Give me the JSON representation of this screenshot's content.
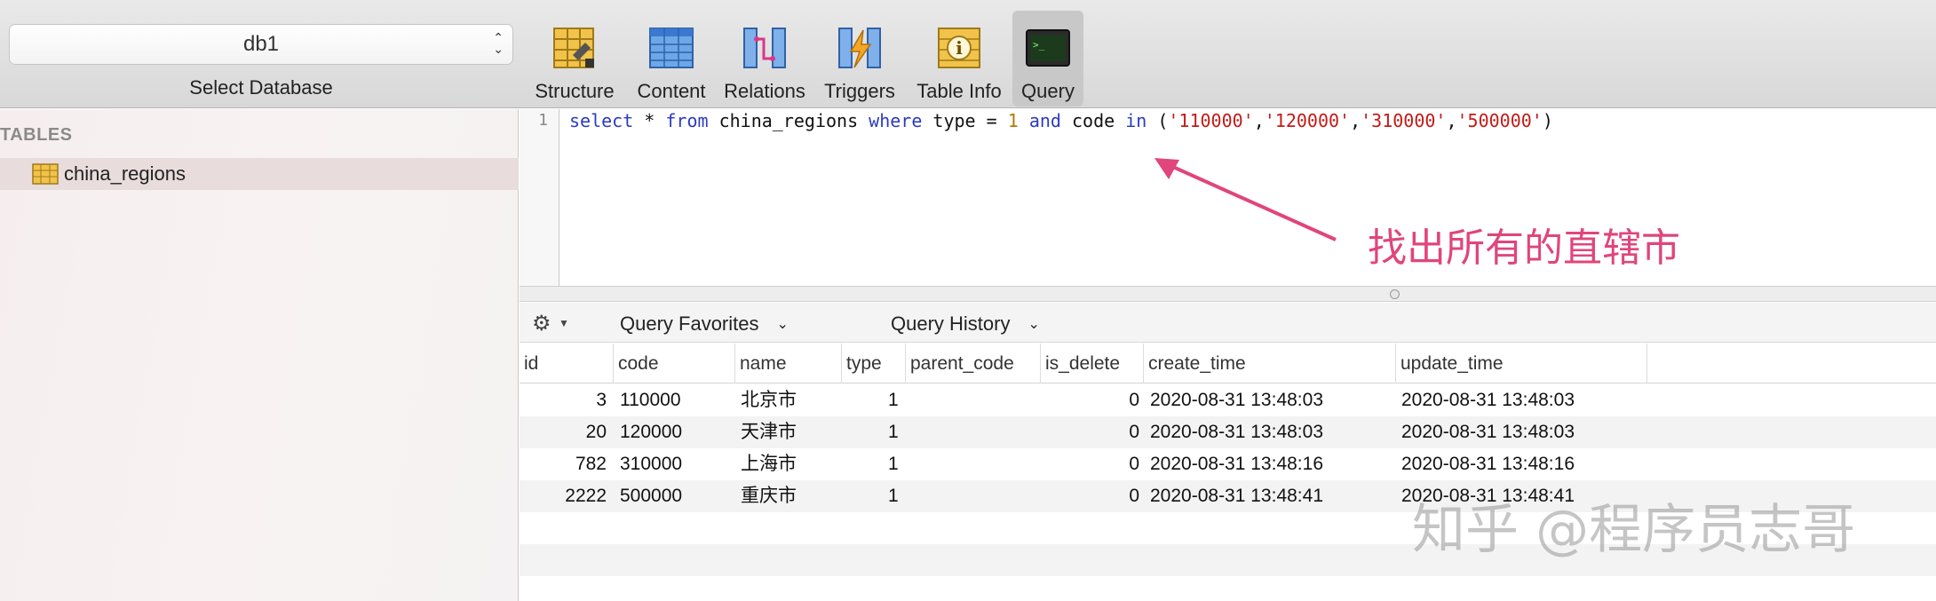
{
  "window": {
    "title": ""
  },
  "toolbar": {
    "database": {
      "value": "db1",
      "caption": "Select Database"
    },
    "buttons": [
      {
        "label": "Structure",
        "icon": "structure-icon"
      },
      {
        "label": "Content",
        "icon": "content-icon"
      },
      {
        "label": "Relations",
        "icon": "relations-icon"
      },
      {
        "label": "Triggers",
        "icon": "triggers-icon"
      },
      {
        "label": "Table Info",
        "icon": "table-info-icon"
      },
      {
        "label": "Query",
        "icon": "query-icon",
        "active": true
      }
    ]
  },
  "sidebar": {
    "header": "TABLES",
    "tables": [
      {
        "label": "china_regions"
      }
    ]
  },
  "editor": {
    "line_number": "1",
    "tokens": {
      "t1": "select",
      "t2": " * ",
      "t3": "from",
      "t4": " china_regions ",
      "t5": "where",
      "t6": " type ",
      "t7": "=",
      "t8": " ",
      "t9": "1",
      "t10": " ",
      "t11": "and",
      "t12": " code ",
      "t13": "in",
      "t14": " (",
      "t15": "'110000'",
      "t16": ",",
      "t17": "'120000'",
      "t18": ",",
      "t19": "'310000'",
      "t20": ",",
      "t21": "'500000'",
      "t22": ")"
    },
    "annotation": "找出所有的直辖市"
  },
  "query_bar": {
    "favorites": "Query Favorites",
    "history": "Query History"
  },
  "results": {
    "columns": [
      "id",
      "code",
      "name",
      "type",
      "parent_code",
      "is_delete",
      "create_time",
      "update_time"
    ],
    "rows": [
      [
        "3",
        "110000",
        "北京市",
        "1",
        "",
        "0",
        "2020-08-31 13:48:03",
        "2020-08-31 13:48:03"
      ],
      [
        "20",
        "120000",
        "天津市",
        "1",
        "",
        "0",
        "2020-08-31 13:48:03",
        "2020-08-31 13:48:03"
      ],
      [
        "782",
        "310000",
        "上海市",
        "1",
        "",
        "0",
        "2020-08-31 13:48:16",
        "2020-08-31 13:48:16"
      ],
      [
        "2222",
        "500000",
        "重庆市",
        "1",
        "",
        "0",
        "2020-08-31 13:48:41",
        "2020-08-31 13:48:41"
      ]
    ]
  },
  "watermark": "知乎 @程序员志哥",
  "colors": {
    "annotation": "#e0457b",
    "keyword": "#2b3bbf",
    "string": "#c41a16",
    "number": "#b17a00"
  }
}
